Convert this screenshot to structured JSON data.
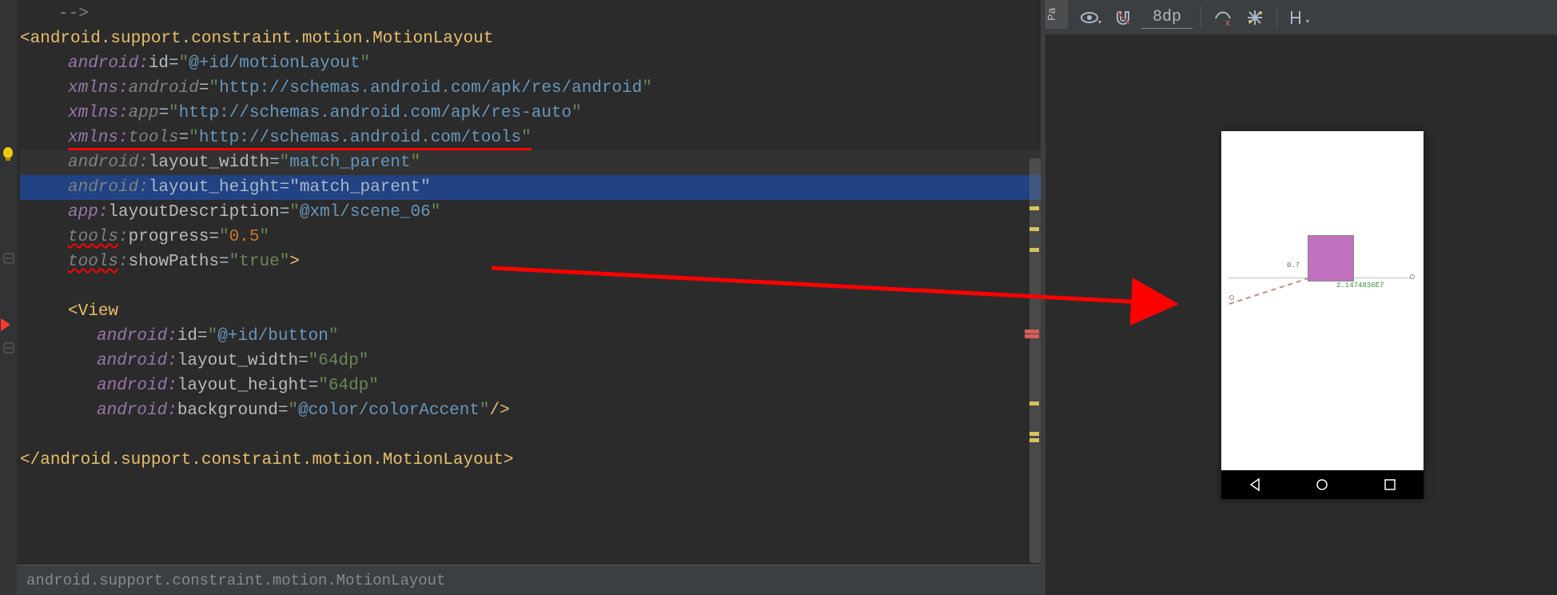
{
  "code": {
    "comment_end": "-->",
    "open_tag": "android.support.constraint.motion.MotionLayout",
    "close_tag": "android.support.constraint.motion.MotionLayout",
    "view_tag": "View",
    "attr_id": {
      "ns": "android",
      "name": "id",
      "val": "@+id/motionLayout"
    },
    "attr_xmlns_android": {
      "ns": "xmlns",
      "name": "android",
      "val": "http://schemas.android.com/apk/res/android"
    },
    "attr_xmlns_app": {
      "ns": "xmlns",
      "name": "app",
      "val": "http://schemas.android.com/apk/res-auto"
    },
    "attr_xmlns_tools": {
      "ns": "xmlns",
      "name": "tools",
      "val": "http://schemas.android.com/tools"
    },
    "attr_lw": {
      "ns": "android",
      "name": "layout_width",
      "val": "match_parent"
    },
    "attr_lh": {
      "ns": "android",
      "name": "layout_height",
      "val": "match_parent"
    },
    "attr_ld": {
      "ns": "app",
      "name": "layoutDescription",
      "val": "@xml/scene_06"
    },
    "attr_prog": {
      "ns": "tools",
      "name": "progress",
      "val": "0.5"
    },
    "attr_paths": {
      "ns": "tools",
      "name": "showPaths",
      "val": "true"
    },
    "view_id": {
      "ns": "android",
      "name": "id",
      "val": "@+id/button"
    },
    "view_lw": {
      "ns": "android",
      "name": "layout_width",
      "val": "64dp"
    },
    "view_lh": {
      "ns": "android",
      "name": "layout_height",
      "val": "64dp"
    },
    "view_bg": {
      "ns": "android",
      "name": "background",
      "val": "@color/colorAccent"
    }
  },
  "breadcrumb": "android.support.constraint.motion.MotionLayout",
  "toolbar": {
    "spacing": "8dp"
  },
  "preview": {
    "label1": "0.7",
    "label2": "2.1474836E7"
  },
  "sidetab": "Pa"
}
